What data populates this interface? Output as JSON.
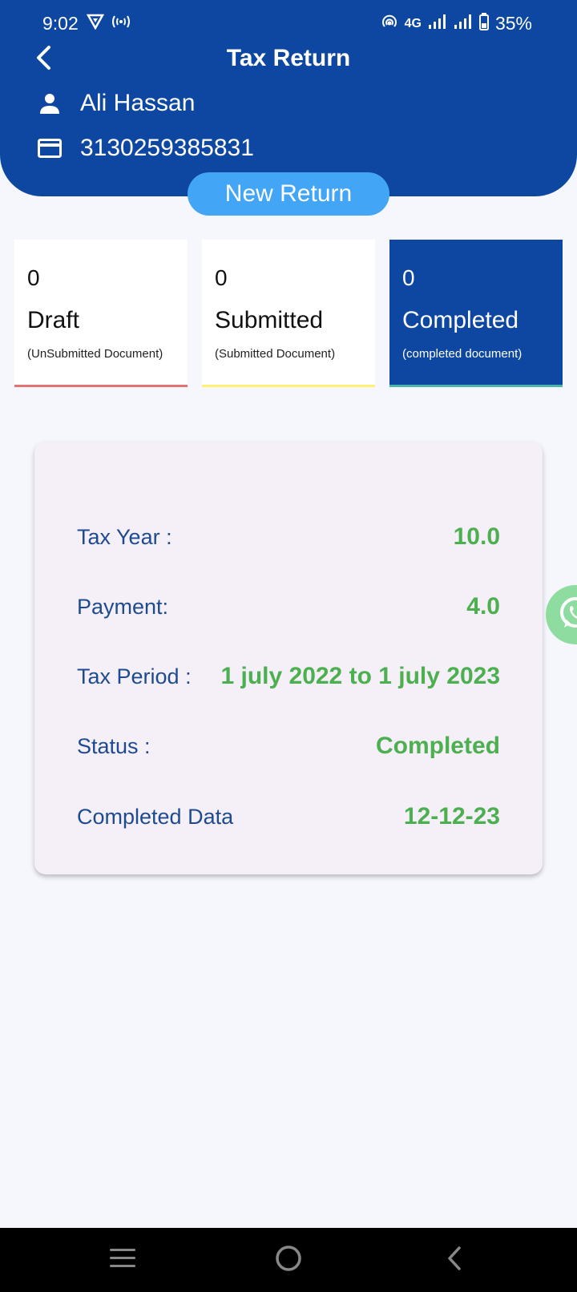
{
  "status_bar": {
    "time": "9:02",
    "network": "4G",
    "battery": "35%"
  },
  "header": {
    "title": "Tax Return",
    "user_name": "Ali Hassan",
    "cnic": "3130259385831",
    "new_return_label": "New Return"
  },
  "stats": [
    {
      "count": "0",
      "label": "Draft",
      "sub": "(UnSubmitted Document)",
      "accent": "#e57373"
    },
    {
      "count": "0",
      "label": "Submitted",
      "sub": "(Submitted Document)",
      "accent": "#fff176"
    },
    {
      "count": "0",
      "label": "Completed",
      "sub": "(completed document)",
      "accent": "#4db6ac"
    }
  ],
  "details": [
    {
      "key": "Tax Year :",
      "value": "10.0"
    },
    {
      "key": "Payment:",
      "value": "4.0"
    },
    {
      "key": "Tax Period :",
      "value": "1 july 2022 to 1 july 2023"
    },
    {
      "key": "Status :",
      "value": "Completed"
    },
    {
      "key": "Completed Data",
      "value": "12-12-23"
    }
  ],
  "colors": {
    "primary": "#0d47a1",
    "button": "#42a5f5",
    "value_green": "#4caf50",
    "key_blue": "#1e4b8f"
  },
  "icons": {
    "back": "chevron-left-icon",
    "user": "person-icon",
    "card": "credit-card-icon",
    "whatsapp": "whatsapp-icon",
    "nav_menu": "menu-icon",
    "nav_home": "home-circle-icon",
    "nav_back": "back-icon"
  }
}
